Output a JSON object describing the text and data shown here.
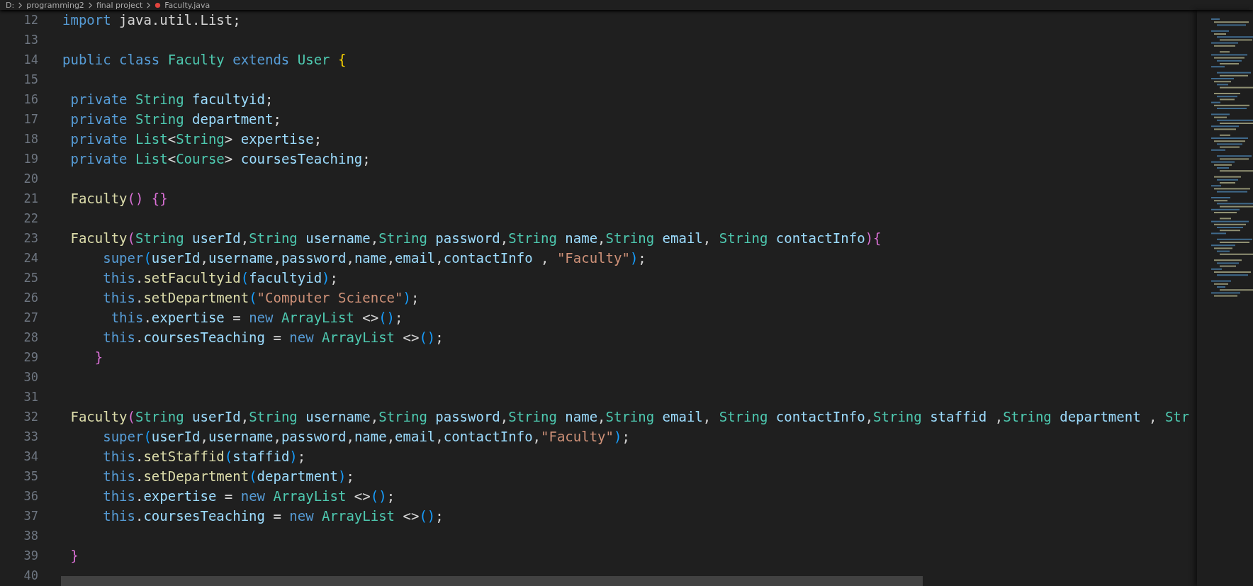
{
  "breadcrumb": [
    {
      "label": "D:",
      "kind": "folder"
    },
    {
      "label": "programming2",
      "kind": "folder"
    },
    {
      "label": "final project",
      "kind": "folder"
    },
    {
      "label": "Faculty.java",
      "kind": "file"
    }
  ],
  "lines": [
    {
      "number": "12",
      "tokens": [
        {
          "kind": "keyword",
          "text": "import"
        },
        {
          "kind": "plain",
          "text": " java.util.List;"
        }
      ]
    },
    {
      "number": "13"
    },
    {
      "number": "14",
      "tokens": [
        {
          "kind": "keyword",
          "text": "public class "
        },
        {
          "kind": "type",
          "text": "Faculty "
        },
        {
          "kind": "keyword",
          "text": "extends "
        },
        {
          "kind": "type",
          "text": "User "
        },
        {
          "kind": "bracket-gold",
          "text": "{"
        }
      ]
    },
    {
      "number": "15"
    },
    {
      "number": "16",
      "tokens": [
        {
          "kind": "keyword",
          "text": " private "
        },
        {
          "kind": "type",
          "text": "String "
        },
        {
          "kind": "variable",
          "text": "facultyid"
        },
        {
          "kind": "plain",
          "text": ";"
        }
      ]
    },
    {
      "number": "17",
      "tokens": [
        {
          "kind": "keyword",
          "text": " private "
        },
        {
          "kind": "type",
          "text": "String "
        },
        {
          "kind": "variable",
          "text": "department"
        },
        {
          "kind": "plain",
          "text": ";"
        }
      ]
    },
    {
      "number": "18",
      "tokens": [
        {
          "kind": "keyword",
          "text": " private "
        },
        {
          "kind": "type",
          "text": "List"
        },
        {
          "kind": "plain",
          "text": "<"
        },
        {
          "kind": "type",
          "text": "String"
        },
        {
          "kind": "plain",
          "text": "> "
        },
        {
          "kind": "variable",
          "text": "expertise"
        },
        {
          "kind": "plain",
          "text": ";"
        }
      ]
    },
    {
      "number": "19",
      "tokens": [
        {
          "kind": "keyword",
          "text": " private "
        },
        {
          "kind": "type",
          "text": "List"
        },
        {
          "kind": "plain",
          "text": "<"
        },
        {
          "kind": "type",
          "text": "Course"
        },
        {
          "kind": "plain",
          "text": "> "
        },
        {
          "kind": "variable",
          "text": "coursesTeaching"
        },
        {
          "kind": "plain",
          "text": ";"
        }
      ]
    },
    {
      "number": "20"
    },
    {
      "number": "21",
      "tokens": [
        {
          "kind": "function",
          "text": " Faculty"
        },
        {
          "kind": "bracket-pink",
          "text": "() {}"
        }
      ]
    },
    {
      "number": "22"
    },
    {
      "number": "23",
      "tokens": [
        {
          "kind": "function",
          "text": " Faculty"
        },
        {
          "kind": "bracket-pink",
          "text": "("
        },
        {
          "kind": "type",
          "text": "String "
        },
        {
          "kind": "variable",
          "text": "userId"
        },
        {
          "kind": "plain",
          "text": ","
        },
        {
          "kind": "type",
          "text": "String "
        },
        {
          "kind": "variable",
          "text": "username"
        },
        {
          "kind": "plain",
          "text": ","
        },
        {
          "kind": "type",
          "text": "String "
        },
        {
          "kind": "variable",
          "text": "password"
        },
        {
          "kind": "plain",
          "text": ","
        },
        {
          "kind": "type",
          "text": "String "
        },
        {
          "kind": "variable",
          "text": "name"
        },
        {
          "kind": "plain",
          "text": ","
        },
        {
          "kind": "type",
          "text": "String "
        },
        {
          "kind": "variable",
          "text": "email"
        },
        {
          "kind": "plain",
          "text": ", "
        },
        {
          "kind": "type",
          "text": "String "
        },
        {
          "kind": "variable",
          "text": "contactInfo"
        },
        {
          "kind": "bracket-pink",
          "text": "){"
        }
      ]
    },
    {
      "number": "24",
      "tokens": [
        {
          "kind": "keyword",
          "text": "     super"
        },
        {
          "kind": "bracket-blue",
          "text": "("
        },
        {
          "kind": "variable",
          "text": "userId"
        },
        {
          "kind": "plain",
          "text": ","
        },
        {
          "kind": "variable",
          "text": "username"
        },
        {
          "kind": "plain",
          "text": ","
        },
        {
          "kind": "variable",
          "text": "password"
        },
        {
          "kind": "plain",
          "text": ","
        },
        {
          "kind": "variable",
          "text": "name"
        },
        {
          "kind": "plain",
          "text": ","
        },
        {
          "kind": "variable",
          "text": "email"
        },
        {
          "kind": "plain",
          "text": ","
        },
        {
          "kind": "variable",
          "text": "contactInfo"
        },
        {
          "kind": "plain",
          "text": " , "
        },
        {
          "kind": "string",
          "text": "\"Faculty\""
        },
        {
          "kind": "bracket-blue",
          "text": ")"
        },
        {
          "kind": "plain",
          "text": ";"
        }
      ]
    },
    {
      "number": "25",
      "tokens": [
        {
          "kind": "keyword",
          "text": "     this"
        },
        {
          "kind": "plain",
          "text": "."
        },
        {
          "kind": "function",
          "text": "setFacultyid"
        },
        {
          "kind": "bracket-blue",
          "text": "("
        },
        {
          "kind": "variable",
          "text": "facultyid"
        },
        {
          "kind": "bracket-blue",
          "text": ")"
        },
        {
          "kind": "plain",
          "text": ";"
        }
      ]
    },
    {
      "number": "26",
      "tokens": [
        {
          "kind": "keyword",
          "text": "     this"
        },
        {
          "kind": "plain",
          "text": "."
        },
        {
          "kind": "function",
          "text": "setDepartment"
        },
        {
          "kind": "bracket-blue",
          "text": "("
        },
        {
          "kind": "string",
          "text": "\"Computer Science\""
        },
        {
          "kind": "bracket-blue",
          "text": ")"
        },
        {
          "kind": "plain",
          "text": ";"
        }
      ]
    },
    {
      "number": "27",
      "tokens": [
        {
          "kind": "keyword",
          "text": "      this"
        },
        {
          "kind": "plain",
          "text": "."
        },
        {
          "kind": "variable",
          "text": "expertise"
        },
        {
          "kind": "plain",
          "text": " = "
        },
        {
          "kind": "keyword",
          "text": "new "
        },
        {
          "kind": "type",
          "text": "ArrayList"
        },
        {
          "kind": "plain",
          "text": " <>"
        },
        {
          "kind": "bracket-blue",
          "text": "()"
        },
        {
          "kind": "plain",
          "text": ";"
        }
      ]
    },
    {
      "number": "28",
      "tokens": [
        {
          "kind": "keyword",
          "text": "     this"
        },
        {
          "kind": "plain",
          "text": "."
        },
        {
          "kind": "variable",
          "text": "coursesTeaching"
        },
        {
          "kind": "plain",
          "text": " = "
        },
        {
          "kind": "keyword",
          "text": "new "
        },
        {
          "kind": "type",
          "text": "ArrayList"
        },
        {
          "kind": "plain",
          "text": " <>"
        },
        {
          "kind": "bracket-blue",
          "text": "()"
        },
        {
          "kind": "plain",
          "text": ";"
        }
      ]
    },
    {
      "number": "29",
      "tokens": [
        {
          "kind": "bracket-pink",
          "text": "    }"
        }
      ]
    },
    {
      "number": "30"
    },
    {
      "number": "31"
    },
    {
      "number": "32",
      "tokens": [
        {
          "kind": "function",
          "text": " Faculty"
        },
        {
          "kind": "bracket-pink",
          "text": "("
        },
        {
          "kind": "type",
          "text": "String "
        },
        {
          "kind": "variable",
          "text": "userId"
        },
        {
          "kind": "plain",
          "text": ","
        },
        {
          "kind": "type",
          "text": "String "
        },
        {
          "kind": "variable",
          "text": "username"
        },
        {
          "kind": "plain",
          "text": ","
        },
        {
          "kind": "type",
          "text": "String "
        },
        {
          "kind": "variable",
          "text": "password"
        },
        {
          "kind": "plain",
          "text": ","
        },
        {
          "kind": "type",
          "text": "String "
        },
        {
          "kind": "variable",
          "text": "name"
        },
        {
          "kind": "plain",
          "text": ","
        },
        {
          "kind": "type",
          "text": "String "
        },
        {
          "kind": "variable",
          "text": "email"
        },
        {
          "kind": "plain",
          "text": ", "
        },
        {
          "kind": "type",
          "text": "String "
        },
        {
          "kind": "variable",
          "text": "contactInfo"
        },
        {
          "kind": "plain",
          "text": ","
        },
        {
          "kind": "type",
          "text": "String "
        },
        {
          "kind": "variable",
          "text": "staffid"
        },
        {
          "kind": "plain",
          "text": " ,"
        },
        {
          "kind": "type",
          "text": "String "
        },
        {
          "kind": "variable",
          "text": "department"
        },
        {
          "kind": "plain",
          "text": " , "
        },
        {
          "kind": "type",
          "text": "Str"
        }
      ]
    },
    {
      "number": "33",
      "tokens": [
        {
          "kind": "keyword",
          "text": "     super"
        },
        {
          "kind": "bracket-blue",
          "text": "("
        },
        {
          "kind": "variable",
          "text": "userId"
        },
        {
          "kind": "plain",
          "text": ","
        },
        {
          "kind": "variable",
          "text": "username"
        },
        {
          "kind": "plain",
          "text": ","
        },
        {
          "kind": "variable",
          "text": "password"
        },
        {
          "kind": "plain",
          "text": ","
        },
        {
          "kind": "variable",
          "text": "name"
        },
        {
          "kind": "plain",
          "text": ","
        },
        {
          "kind": "variable",
          "text": "email"
        },
        {
          "kind": "plain",
          "text": ","
        },
        {
          "kind": "variable",
          "text": "contactInfo"
        },
        {
          "kind": "plain",
          "text": ","
        },
        {
          "kind": "string",
          "text": "\"Faculty\""
        },
        {
          "kind": "bracket-blue",
          "text": ")"
        },
        {
          "kind": "plain",
          "text": ";"
        }
      ]
    },
    {
      "number": "34",
      "tokens": [
        {
          "kind": "keyword",
          "text": "     this"
        },
        {
          "kind": "plain",
          "text": "."
        },
        {
          "kind": "function",
          "text": "setStaffid"
        },
        {
          "kind": "bracket-blue",
          "text": "("
        },
        {
          "kind": "variable",
          "text": "staffid"
        },
        {
          "kind": "bracket-blue",
          "text": ")"
        },
        {
          "kind": "plain",
          "text": ";"
        }
      ]
    },
    {
      "number": "35",
      "tokens": [
        {
          "kind": "keyword",
          "text": "     this"
        },
        {
          "kind": "plain",
          "text": "."
        },
        {
          "kind": "function",
          "text": "setDepartment"
        },
        {
          "kind": "bracket-blue",
          "text": "("
        },
        {
          "kind": "variable",
          "text": "department"
        },
        {
          "kind": "bracket-blue",
          "text": ")"
        },
        {
          "kind": "plain",
          "text": ";"
        }
      ]
    },
    {
      "number": "36",
      "tokens": [
        {
          "kind": "keyword",
          "text": "     this"
        },
        {
          "kind": "plain",
          "text": "."
        },
        {
          "kind": "variable",
          "text": "expertise"
        },
        {
          "kind": "plain",
          "text": " = "
        },
        {
          "kind": "keyword",
          "text": "new "
        },
        {
          "kind": "type",
          "text": "ArrayList"
        },
        {
          "kind": "plain",
          "text": " <>"
        },
        {
          "kind": "bracket-blue",
          "text": "()"
        },
        {
          "kind": "plain",
          "text": ";"
        }
      ]
    },
    {
      "number": "37",
      "tokens": [
        {
          "kind": "keyword",
          "text": "     this"
        },
        {
          "kind": "plain",
          "text": "."
        },
        {
          "kind": "variable",
          "text": "coursesTeaching"
        },
        {
          "kind": "plain",
          "text": " = "
        },
        {
          "kind": "keyword",
          "text": "new "
        },
        {
          "kind": "type",
          "text": "ArrayList"
        },
        {
          "kind": "plain",
          "text": " <>"
        },
        {
          "kind": "bracket-blue",
          "text": "()"
        },
        {
          "kind": "plain",
          "text": ";"
        }
      ]
    },
    {
      "number": "38"
    },
    {
      "number": "39",
      "tokens": [
        {
          "kind": "bracket-pink",
          "text": " }"
        }
      ]
    },
    {
      "number": "40"
    }
  ]
}
